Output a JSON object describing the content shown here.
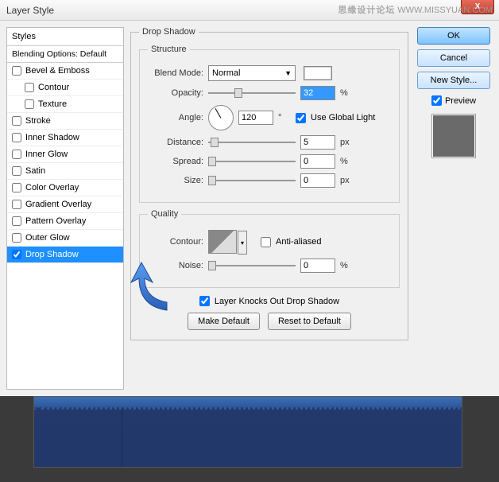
{
  "watermark": {
    "main": "思缘设计论坛",
    "sub": "WWW.MISSYUAN.COM"
  },
  "titlebar": {
    "title": "Layer Style",
    "close": "X"
  },
  "styles": {
    "header": "Styles",
    "blending": "Blending Options: Default",
    "items": [
      {
        "label": "Bevel & Emboss",
        "checked": false
      },
      {
        "label": "Contour",
        "checked": false,
        "indent": true
      },
      {
        "label": "Texture",
        "checked": false,
        "indent": true
      },
      {
        "label": "Stroke",
        "checked": false
      },
      {
        "label": "Inner Shadow",
        "checked": false
      },
      {
        "label": "Inner Glow",
        "checked": false
      },
      {
        "label": "Satin",
        "checked": false
      },
      {
        "label": "Color Overlay",
        "checked": false
      },
      {
        "label": "Gradient Overlay",
        "checked": false
      },
      {
        "label": "Pattern Overlay",
        "checked": false
      },
      {
        "label": "Outer Glow",
        "checked": false
      },
      {
        "label": "Drop Shadow",
        "checked": true,
        "selected": true
      }
    ]
  },
  "effect": {
    "title": "Drop Shadow",
    "structure": {
      "legend": "Structure",
      "blend_label": "Blend Mode:",
      "blend_value": "Normal",
      "opacity_label": "Opacity:",
      "opacity_value": "32",
      "opacity_unit": "%",
      "angle_label": "Angle:",
      "angle_value": "120",
      "angle_unit": "°",
      "global_label": "Use Global Light",
      "global_checked": true,
      "distance_label": "Distance:",
      "distance_value": "5",
      "distance_unit": "px",
      "spread_label": "Spread:",
      "spread_value": "0",
      "spread_unit": "%",
      "size_label": "Size:",
      "size_value": "0",
      "size_unit": "px"
    },
    "quality": {
      "legend": "Quality",
      "contour_label": "Contour:",
      "anti_label": "Anti-aliased",
      "anti_checked": false,
      "noise_label": "Noise:",
      "noise_value": "0",
      "noise_unit": "%"
    },
    "knockout_label": "Layer Knocks Out Drop Shadow",
    "knockout_checked": true,
    "make_default": "Make Default",
    "reset_default": "Reset to Default"
  },
  "buttons": {
    "ok": "OK",
    "cancel": "Cancel",
    "new_style": "New Style...",
    "preview": "Preview",
    "preview_checked": true
  }
}
